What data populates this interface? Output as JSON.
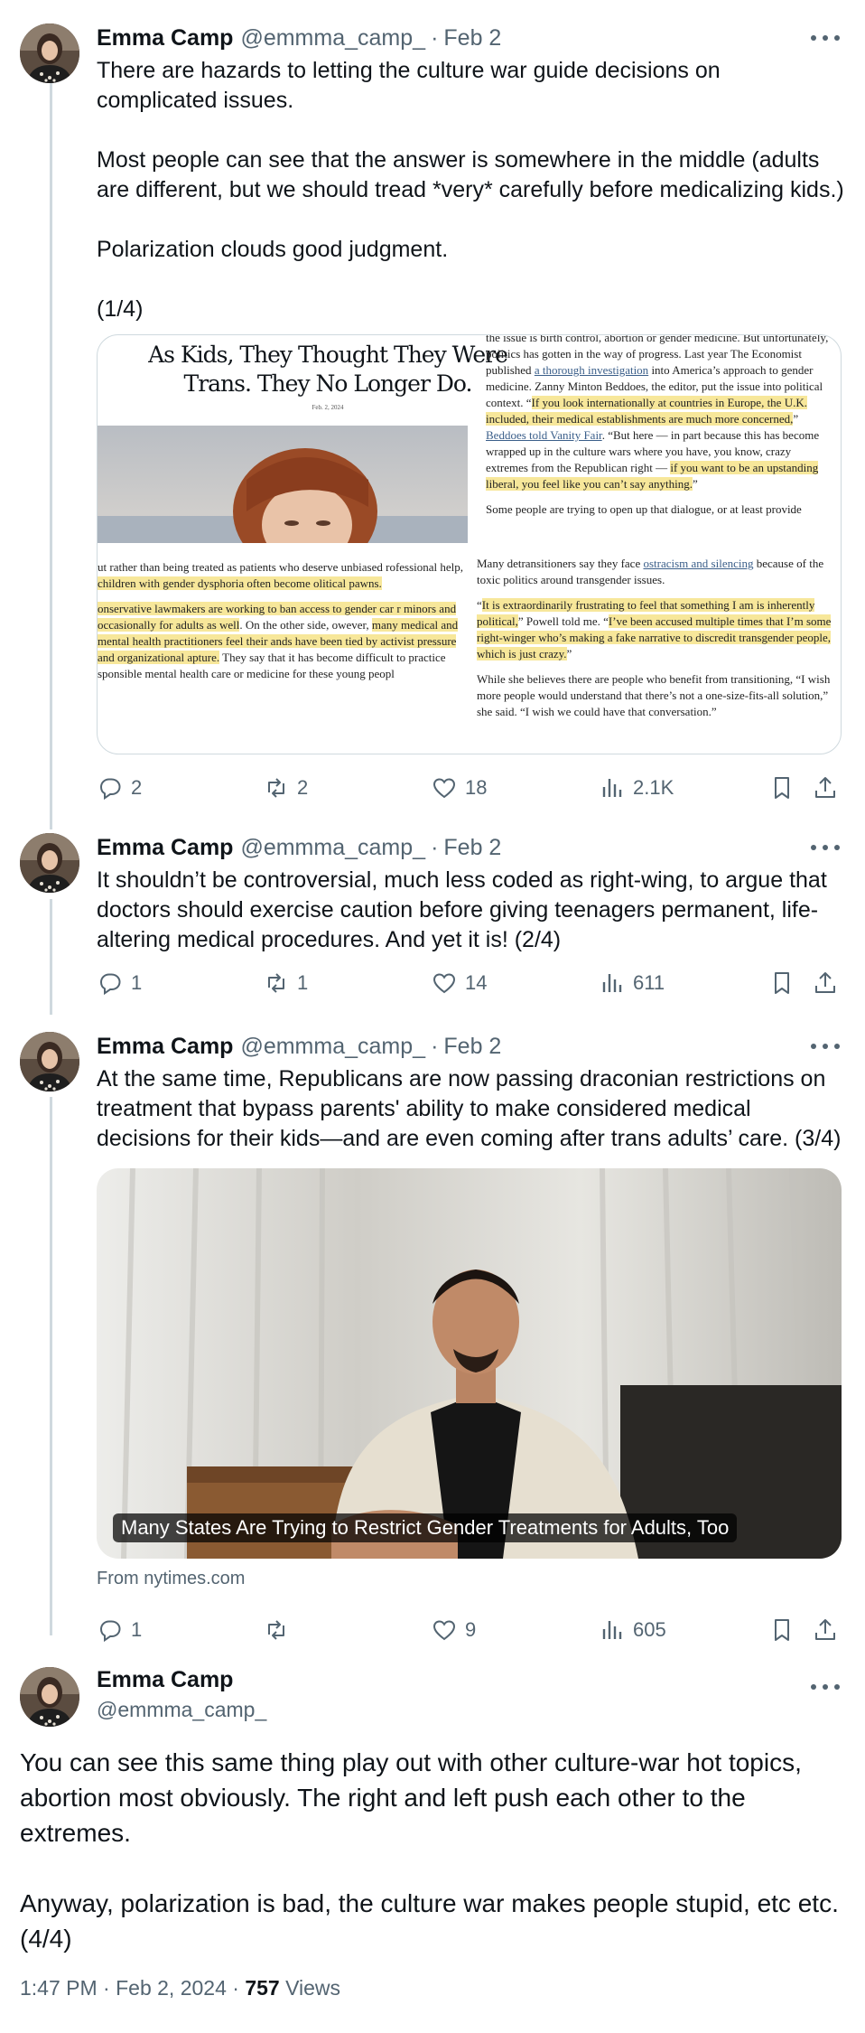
{
  "author": {
    "name": "Emma Camp",
    "handle": "@emmma_camp_"
  },
  "colors": {
    "text": "#0f1419",
    "muted": "#536471",
    "thread_line": "#cfd9de",
    "highlight": "#f7e79a"
  },
  "tweets": [
    {
      "date": "Feb 2",
      "text": "There are hazards to letting the culture war guide decisions on complicated issues.\n\nMost people can see that the answer is somewhere in the middle (adults are different, but we should tread *very* carefully before medicalizing kids.)\n\nPolarization clouds good judgment.\n\n(1/4)",
      "stats": {
        "replies": "2",
        "reposts": "2",
        "likes": "18",
        "views": "2.1K"
      }
    },
    {
      "date": "Feb 2",
      "text": "It shouldn’t be controversial, much less coded as right-wing, to argue that doctors should exercise caution before giving teenagers permanent, life-altering medical procedures. And yet it is! (2/4)",
      "stats": {
        "replies": "1",
        "reposts": "1",
        "likes": "14",
        "views": "611"
      }
    },
    {
      "date": "Feb 2",
      "text": "At the same time, Republicans are now passing draconian restrictions on treatment that bypass parents' ability to make considered medical decisions for their kids—and are even coming after trans adults’ care. (3/4)",
      "stats": {
        "replies": "1",
        "reposts": "",
        "likes": "9",
        "views": "605"
      }
    }
  ],
  "article_card": {
    "title_line1": "As Kids, They Thought They Were",
    "title_line2": "Trans. They No Longer Do.",
    "date": "Feb. 2, 2024",
    "right_col_top": {
      "cut": "the issue is birth control, abortion or gender medicine. But",
      "a": "unfortunately, politics has gotten in the way of progress. Last year The Economist published ",
      "link1": "a thorough investigation",
      "b": " into America’s approach to gender medicine. Zanny Minton Beddoes, the editor, put the issue into political context. “",
      "hl1": "If you look internationally at countries in Europe, the U.K. included, their medical establishments are much more concerned,",
      "c": "” ",
      "link2": "Beddoes told Vanity Fair",
      "d": ". “But here — in part because this has become wrapped up in the culture wars where you have, you know, crazy extremes from the Republican right — ",
      "hl2": "if you want to be an upstanding liberal, you feel like you can’t say anything.",
      "e": "”",
      "p2": "Some people are trying to open up that dialogue, or at least provide"
    },
    "left_col": {
      "p1a": "ut rather than being treated as patients who deserve unbiased rofessional help, ",
      "p1hl": "children with gender dysphoria often become olitical pawns.",
      "p2hl1": "onservative lawmakers are working to ban access to gender car r minors and occasionally for adults as well",
      "p2a": ". On the other side, owever, ",
      "p2hl2": "many medical and mental health practitioners feel their ands have been tied by activist pressure and organizational apture.",
      "p2b": " They say that it has become difficult to practice sponsible mental health care or medicine for these young peopl"
    },
    "right_col_bottom": {
      "p1a": "Many detransitioners say they face ",
      "p1link": "ostracism and silencing",
      "p1b": " because of the toxic politics around transgender issues.",
      "p2a": "“",
      "p2hl1": "It is extraordinarily frustrating to feel that something I am is inherently political,",
      "p2b": "” Powell told me. “",
      "p2hl2": "I’ve been accused multiple times that I’m some right-winger who’s making a fake narrative to discredit transgender people, which is just crazy.",
      "p2c": "”",
      "p3": "While she believes there are people who benefit from transitioning, “I wish more people would understand that there’s not a one-size-fits-all solution,” she said. “I wish we could have that conversation.”"
    }
  },
  "link_card": {
    "caption": "Many States Are Trying to Restrict Gender Treatments for Adults, Too",
    "from": "From nytimes.com"
  },
  "final_tweet": {
    "text": "You can see this same thing play out with other culture-war hot topics, abortion most obviously. The right and left push each other to the extremes.\n\nAnyway, polarization is bad, the culture war makes people stupid, etc etc. (4/4)",
    "time": "1:47 PM",
    "date": "Feb 2, 2024",
    "views_count": "757",
    "views_label": "Views"
  },
  "icons": [
    "reply-icon",
    "repost-icon",
    "like-icon",
    "views-icon",
    "bookmark-icon",
    "share-icon",
    "more-icon"
  ]
}
